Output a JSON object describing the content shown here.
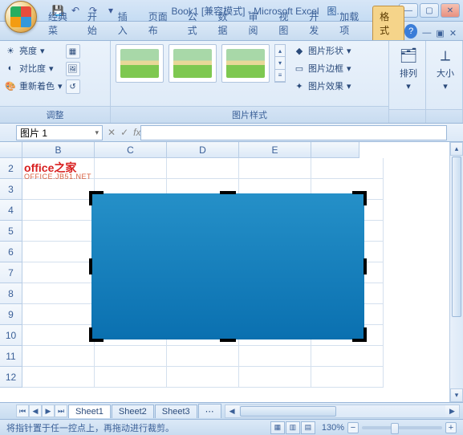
{
  "title": {
    "doc": "Book1",
    "mode": "[兼容模式]",
    "app": "Microsoft Excel",
    "tool": "图..."
  },
  "qat": {
    "save": "💾",
    "undo": "↶",
    "redo": "↷"
  },
  "tabs": [
    "经典菜",
    "开始",
    "插入",
    "页面布",
    "公式",
    "数据",
    "审阅",
    "视图",
    "开发",
    "加载项",
    "格式"
  ],
  "activeTab": 10,
  "ribbon": {
    "adjust": {
      "label": "调整",
      "brightness": "亮度",
      "contrast": "对比度",
      "recolor": "重新着色"
    },
    "styles": {
      "label": "图片样式",
      "shape": "图片形状",
      "border": "图片边框",
      "effects": "图片效果"
    },
    "arrange": {
      "label": "排列"
    },
    "size": {
      "label": "大小"
    }
  },
  "namebox": "图片 1",
  "fx": "fx",
  "columns": [
    "B",
    "C",
    "D",
    "E"
  ],
  "rows": [
    "2",
    "3",
    "4",
    "5",
    "6",
    "7",
    "8",
    "9",
    "10",
    "11",
    "12"
  ],
  "watermark": {
    "main": "office之家",
    "sub": "OFFICE.JB51.NET"
  },
  "sheets": [
    "Sheet1",
    "Sheet2",
    "Sheet3"
  ],
  "status": "将指针置于任一控点上，再拖动进行裁剪。",
  "zoom": "130%"
}
